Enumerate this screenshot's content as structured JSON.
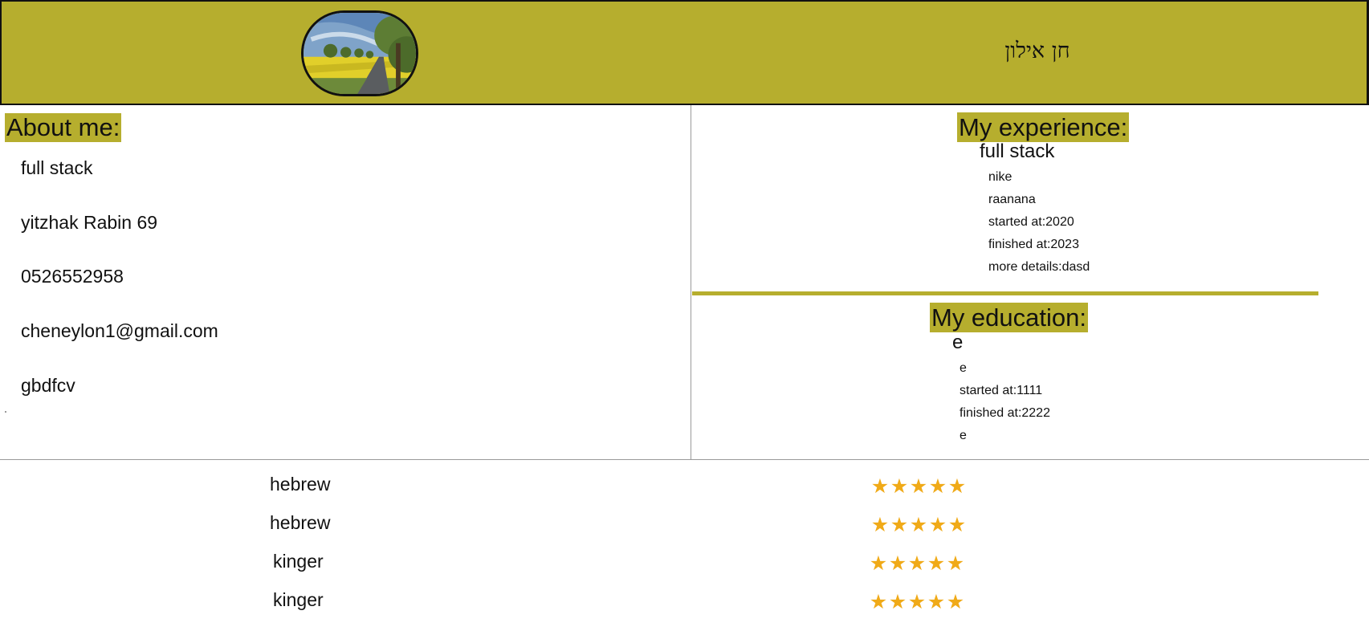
{
  "header": {
    "name": "חן אילון",
    "avatar_icon": "landscape-photo"
  },
  "about": {
    "title": "About me:",
    "items": [
      "full stack",
      "yitzhak Rabin 69",
      "0526552958",
      "cheneylon1@gmail.com",
      "gbdfcv"
    ]
  },
  "experience": {
    "title": "My experience:",
    "role": "full stack",
    "company": "nike",
    "location": "raanana",
    "started": "started at:2020",
    "finished": "finished at:2023",
    "details": "more details:dasd"
  },
  "education": {
    "title": "My education:",
    "degree": "e",
    "institution": "e",
    "started": "started at:1111",
    "finished": "finished at:2222",
    "details": "e"
  },
  "languages": [
    {
      "name": "hebrew",
      "rating": 5,
      "stars": "★★★★★"
    },
    {
      "name": "hebrew",
      "rating": 5,
      "stars": "★★★★★"
    },
    {
      "name": "kinger",
      "rating": 5,
      "stars": "★★★★★"
    },
    {
      "name": "kinger",
      "rating": 5,
      "stars": "★★★★★"
    }
  ],
  "colors": {
    "accent": "#b6ae2e",
    "star": "#f0aa18"
  }
}
